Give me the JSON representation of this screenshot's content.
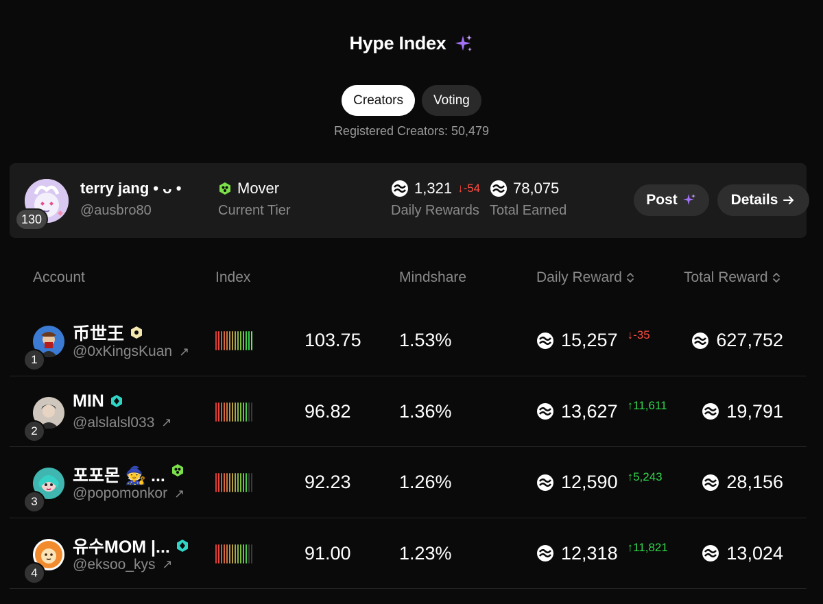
{
  "header": {
    "title": "Hype Index",
    "tabs": [
      {
        "label": "Creators",
        "active": true
      },
      {
        "label": "Voting",
        "active": false
      }
    ],
    "registered_label": "Registered Creators: 50,479"
  },
  "colors": {
    "background": "#0a0a0a",
    "card": "#1b1b1b",
    "accent_purple": "#a371f7",
    "up_green": "#32d74b",
    "down_red": "#ff4b3e",
    "tier_green": "#7be04a",
    "tier_teal": "#2fd6c7",
    "tier_gold": "#f5e7b0"
  },
  "user_card": {
    "rank": "130",
    "name": "terry jang • ᴗ •",
    "handle": "@ausbro80",
    "tier": "Mover",
    "tier_label": "Current Tier",
    "daily_rewards": "1,321",
    "daily_change": "↓-54",
    "daily_label": "Daily Rewards",
    "total_earned": "78,075",
    "total_label": "Total Earned",
    "post_label": "Post",
    "details_label": "Details",
    "details_icon": "arrow-right-icon"
  },
  "table": {
    "columns": {
      "account": "Account",
      "index": "Index",
      "mindshare": "Mindshare",
      "daily_reward": "Daily Reward",
      "total_reward": "Total Reward"
    },
    "rows": [
      {
        "rank": "1",
        "name": "币世王",
        "handle": "@0xKingsKuan",
        "tier": "gold",
        "index": "103.75",
        "index_level": 1.0,
        "mindshare": "1.53%",
        "daily": "15,257",
        "change": "↓-35",
        "direction": "down",
        "total": "627,752"
      },
      {
        "rank": "2",
        "name": "MIN",
        "handle": "@alslalsl033",
        "tier": "teal",
        "index": "96.82",
        "index_level": 0.93,
        "mindshare": "1.36%",
        "daily": "13,627",
        "change": "↑11,611",
        "direction": "up",
        "total": "19,791"
      },
      {
        "rank": "3",
        "name": "포포몬 🧙 ...",
        "handle": "@popomonkor",
        "tier": "green",
        "index": "92.23",
        "index_level": 0.93,
        "mindshare": "1.26%",
        "daily": "12,590",
        "change": "↑5,243",
        "direction": "up",
        "total": "28,156"
      },
      {
        "rank": "4",
        "name": "유수MOM |...",
        "handle": "@eksoo_kys",
        "tier": "teal",
        "index": "91.00",
        "index_level": 0.93,
        "mindshare": "1.23%",
        "daily": "12,318",
        "change": "↑11,821",
        "direction": "up",
        "total": "13,024"
      }
    ]
  }
}
